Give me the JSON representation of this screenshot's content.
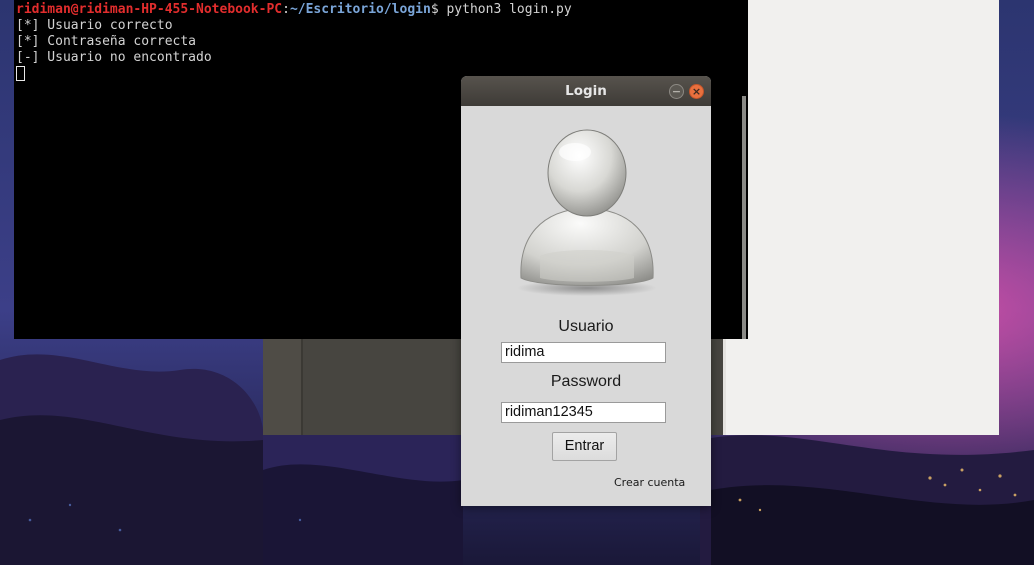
{
  "terminal": {
    "prompt_user": "ridiman@ridiman-HP-455-Notebook-PC",
    "prompt_sep": ":",
    "prompt_path": "~/Escritorio/login",
    "prompt_symbol": "$",
    "command": " python3 login.py",
    "output": [
      "[*] Usuario correcto",
      "[*] Contraseña correcta",
      "[-] Usuario no encontrado"
    ]
  },
  "login_window": {
    "title": "Login",
    "minimize_icon": "minimize-icon",
    "close_icon": "close-icon",
    "avatar_icon": "user-avatar-icon",
    "usuario_label": "Usuario",
    "usuario_value": "ridima",
    "password_label": "Password",
    "password_value": "ridiman12345",
    "entrar_button": "Entrar",
    "crear_cuenta_link": "Crear cuenta"
  },
  "colors": {
    "prompt_user": "#e22d2d",
    "prompt_path": "#7aa5d8",
    "close_button": "#e8703e",
    "titlebar": "#3e3b37"
  }
}
